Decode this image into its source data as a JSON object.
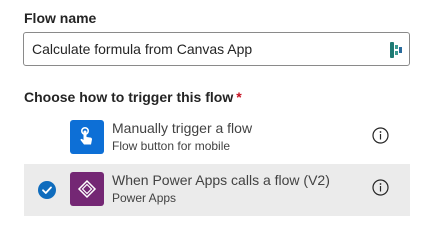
{
  "flow_name": {
    "label": "Flow name",
    "value": "Calculate formula from Canvas App"
  },
  "trigger": {
    "label": "Choose how to trigger this flow",
    "required_mark": "*",
    "options": [
      {
        "title": "Manually trigger a flow",
        "subtitle": "Flow button for mobile",
        "icon": "hand-tap-icon",
        "selected": false
      },
      {
        "title": "When Power Apps calls a flow (V2)",
        "subtitle": "Power Apps",
        "icon": "power-apps-icon",
        "selected": true
      }
    ]
  },
  "colors": {
    "accent": "#0f6cbd",
    "manual_icon_bg": "#0d6fd6",
    "power_apps_icon_bg": "#742774",
    "selected_row_bg": "#ebebeb",
    "required": "#c50f1f"
  }
}
